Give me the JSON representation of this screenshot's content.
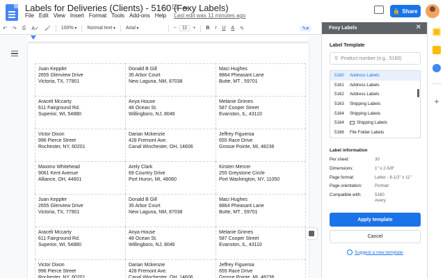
{
  "title": "Labels for Deliveries (Clients) - 5160 (Foxy Labels)",
  "title_icons": [
    "☆",
    "⊡",
    "☁"
  ],
  "menus": [
    "File",
    "Edit",
    "View",
    "Insert",
    "Format",
    "Tools",
    "Add-ons",
    "Help"
  ],
  "last_edit": "Last edit was 11 minutes ago",
  "share_label": "Share",
  "toolbar": {
    "undo": "↶",
    "redo": "↷",
    "print": "⎙",
    "spell": "A✓",
    "paint": "🖌",
    "zoom": "100%",
    "style": "Normal text",
    "font": "Arial",
    "size_minus": "−",
    "size": "11",
    "size_plus": "+",
    "bold": "B",
    "italic": "I",
    "underline": "U",
    "color": "A",
    "highlight": "✎",
    "pen": "✎▾"
  },
  "labels": [
    [
      "Juan Keppler",
      "2655  Glenview Drive",
      "Victoria, TX, 77901"
    ],
    [
      "Donald B Gill",
      "35  Arbor Court",
      "New Laguna, NM, 87038"
    ],
    [
      "Maci Hughes",
      "8864 Pheasant Lane",
      "Butte, MT , 59701"
    ],
    [
      "Araceli Mccarty",
      "611 Fairground Rd.",
      "Superior, WI, 54880"
    ],
    [
      "Anya House",
      "48 Ocean St.",
      "Willingboro, NJ, 8046"
    ],
    [
      "Melanie Grimes",
      "587 Cooper Street",
      "Evanston, IL, 43110"
    ],
    [
      "Victor Dixon",
      "996 Pierce Street",
      "Rochester, NY, 60201"
    ],
    [
      "Darian Mckenzie",
      "428 Fremont Ave.",
      "Canal Winchester, OH, 14606"
    ],
    [
      "Jeffrey Figueroa",
      "655 Race Drive",
      "Grosse Pointe, MI, 48236"
    ],
    [
      "Maximo Whitehead",
      "9061 Kent Avenue",
      "Alliance, OH, 44601"
    ],
    [
      "Arely Clark",
      "69 Country Drive",
      "Port Huron, MI, 48060"
    ],
    [
      "Kirsten Mercer",
      "255 Greystone Circle",
      "Port Washington, NY, 11050"
    ],
    [
      "Juan Keppler",
      "2655  Glenview Drive",
      "Victoria, TX, 77901"
    ],
    [
      "Donald B Gill",
      "35  Arbor Court",
      "New Laguna, NM, 87038"
    ],
    [
      "Maci Hughes",
      "8864 Pheasant Lane",
      "Butte, MT , 59701"
    ],
    [
      "Araceli Mccarty",
      "611 Fairground Rd.",
      "Superior, WI, 54880"
    ],
    [
      "Anya House",
      "48 Ocean St.",
      "Willingboro, NJ, 8046"
    ],
    [
      "Melanie Grimes",
      "587 Cooper Street",
      "Evanston, IL, 43110"
    ],
    [
      "Victor Dixon",
      "996 Pierce Street",
      "Rochester, NY, 60201"
    ],
    [
      "Darian Mckenzie",
      "428 Fremont Ave.",
      "Canal Winchester, OH, 14606"
    ],
    [
      "Jeffrey Figueroa",
      "655 Race Drive",
      "Grosse Pointe, MI, 48236"
    ]
  ],
  "sidebar": {
    "header": "Foxy Labels",
    "close": "✕",
    "section_title": "Label Template",
    "search_placeholder": "Product number (e.g., 5160)",
    "search_icon": "⚲",
    "templates": [
      {
        "code": "5160",
        "name": "Address Labels",
        "selected": true,
        "folder": false
      },
      {
        "code": "5161",
        "name": "Address Labels",
        "selected": false,
        "folder": false
      },
      {
        "code": "5162",
        "name": "Address Labels",
        "selected": false,
        "folder": false
      },
      {
        "code": "5163",
        "name": "Shipping Labels",
        "selected": false,
        "folder": false
      },
      {
        "code": "5164",
        "name": "Shipping Labels",
        "selected": false,
        "folder": false
      },
      {
        "code": "5164",
        "name": "Shipping Labels",
        "selected": false,
        "folder": true
      },
      {
        "code": "5166",
        "name": "File Folder Labels",
        "selected": false,
        "folder": false
      }
    ],
    "info_title": "Label information",
    "info": [
      {
        "key": "Per sheet:",
        "value": "30"
      },
      {
        "key": "Dimensions:",
        "value": "1\" x 2-5/8\""
      },
      {
        "key": "Page format:",
        "value": "Letter - 8-1/2\" x 11\""
      },
      {
        "key": "Page orientation:",
        "value": "Portrait"
      },
      {
        "key": "Compatible with:",
        "value": "5160\nAvery"
      }
    ],
    "apply": "Apply template",
    "cancel": "Cancel",
    "suggest": "Suggest a new template"
  },
  "side_panel": {
    "plus": "+",
    "arrow": "›"
  },
  "colors": {
    "accent": "#1a73e8",
    "sidebar_header": "#5f6368"
  }
}
